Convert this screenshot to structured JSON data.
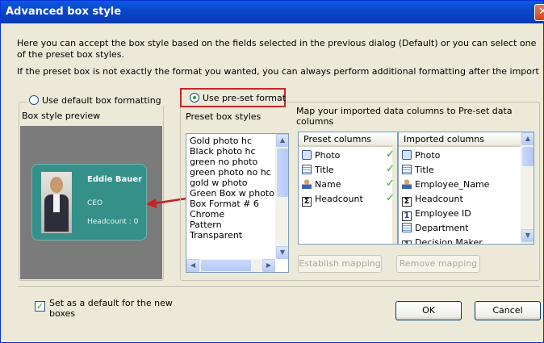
{
  "window": {
    "title": "Advanced box style",
    "close_glyph": "✕"
  },
  "intro": {
    "line1": "Here you can accept the box style based on the fields selected in the previous dialog (Default) or you can select one of the preset box styles.",
    "line2": "If the preset box is not exactly the format you wanted, you can always perform additional formatting after the import"
  },
  "left": {
    "radio_label": "Use default box formatting",
    "preview_label": "Box style preview",
    "card": {
      "name": "Eddie Bauer",
      "title": "CEO",
      "headcount": "Headcount : 0"
    }
  },
  "right": {
    "radio_label": "Use pre-set format",
    "styles_label": "Preset box styles",
    "map_label": "Map your imported data columns to Pre-set data columns",
    "styles": [
      "Gold photo hc",
      "Black photo hc",
      "green no photo",
      "green photo no hc",
      "gold w photo",
      "Green Box w photo",
      "Box Format # 6",
      "Chrome",
      "Pattern",
      "Transparent"
    ],
    "preset_header": "Preset columns",
    "imported_header": "Imported columns",
    "preset_columns": [
      {
        "icon": "photo-icon",
        "label": "Photo"
      },
      {
        "icon": "doc-icon",
        "label": "Title"
      },
      {
        "icon": "person-icon",
        "label": "Name"
      },
      {
        "icon": "sigma-icon",
        "label": "Headcount"
      }
    ],
    "imported_columns": [
      {
        "icon": "photo-icon",
        "label": "Photo"
      },
      {
        "icon": "doc-icon",
        "label": "Title"
      },
      {
        "icon": "person-icon",
        "label": "Employee_Name"
      },
      {
        "icon": "sigma-icon",
        "label": "Headcount"
      },
      {
        "icon": "number-icon",
        "label": "Employee ID"
      },
      {
        "icon": "doc-icon",
        "label": "Department"
      },
      {
        "icon": "number-icon",
        "label": "Decision Maker"
      }
    ],
    "establish_label": "Establish mapping",
    "remove_label": "Remove mapping"
  },
  "bottom": {
    "default_checkbox_label": "Set as a default for the new boxes",
    "ok_label": "OK",
    "cancel_label": "Cancel"
  },
  "colors": {
    "titlebar": "#0a4fd2",
    "card": "#35908a",
    "highlight_border": "#c8262b",
    "arrow": "#cc1f1f",
    "check": "#36a436"
  }
}
